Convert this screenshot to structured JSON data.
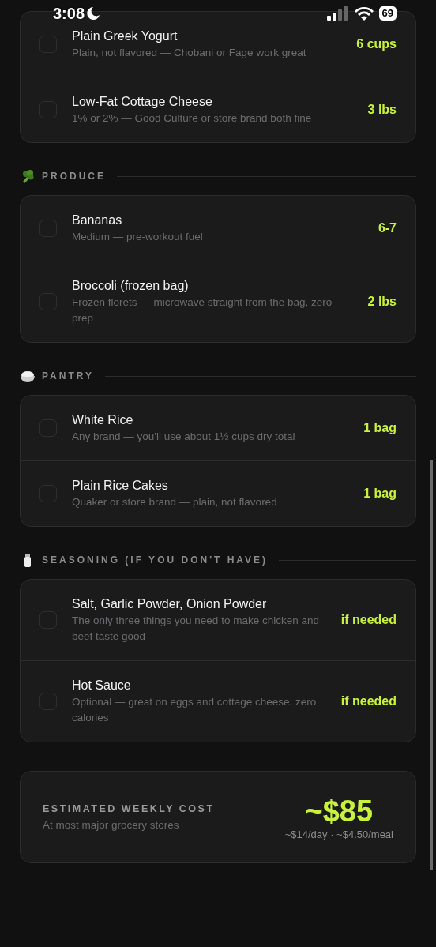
{
  "status_bar": {
    "time": "3:08",
    "battery": "69"
  },
  "sections": [
    {
      "items": [
        {
          "name": "Plain Greek Yogurt",
          "note": "Plain, not flavored — Chobani or Fage work great",
          "qty": "6 cups",
          "checked": false
        },
        {
          "name": "Low-Fat Cottage Cheese",
          "note": "1% or 2% — Good Culture or store brand both fine",
          "qty": "3 lbs",
          "checked": false
        }
      ]
    },
    {
      "title": "PRODUCE",
      "kind": "broccoli",
      "items": [
        {
          "name": "Bananas",
          "note": "Medium — pre-workout fuel",
          "qty": "6-7",
          "checked": false
        },
        {
          "name": "Broccoli (frozen bag)",
          "note": "Frozen florets — microwave straight from the bag, zero prep",
          "qty": "2 lbs",
          "checked": false
        }
      ]
    },
    {
      "title": "PANTRY",
      "kind": "rice",
      "items": [
        {
          "name": "White Rice",
          "note": "Any brand — you'll use about 1½ cups dry total",
          "qty": "1 bag",
          "checked": false
        },
        {
          "name": "Plain Rice Cakes",
          "note": "Quaker or store brand — plain, not flavored",
          "qty": "1 bag",
          "checked": false
        }
      ]
    },
    {
      "title": "SEASONING (IF YOU DON'T HAVE)",
      "kind": "salt",
      "items": [
        {
          "name": "Salt, Garlic Powder, Onion Powder",
          "note": "The only three things you need to make chicken and beef taste good",
          "qty": "if needed",
          "checked": false
        },
        {
          "name": "Hot Sauce",
          "note": "Optional — great on eggs and cottage cheese, zero calories",
          "qty": "if needed",
          "checked": false
        }
      ]
    }
  ],
  "total": {
    "label": "ESTIMATED WEEKLY COST",
    "note": "At most major grocery stores",
    "price": "~$85",
    "breakdown": "~$14/day · ~$4.50/meal"
  }
}
